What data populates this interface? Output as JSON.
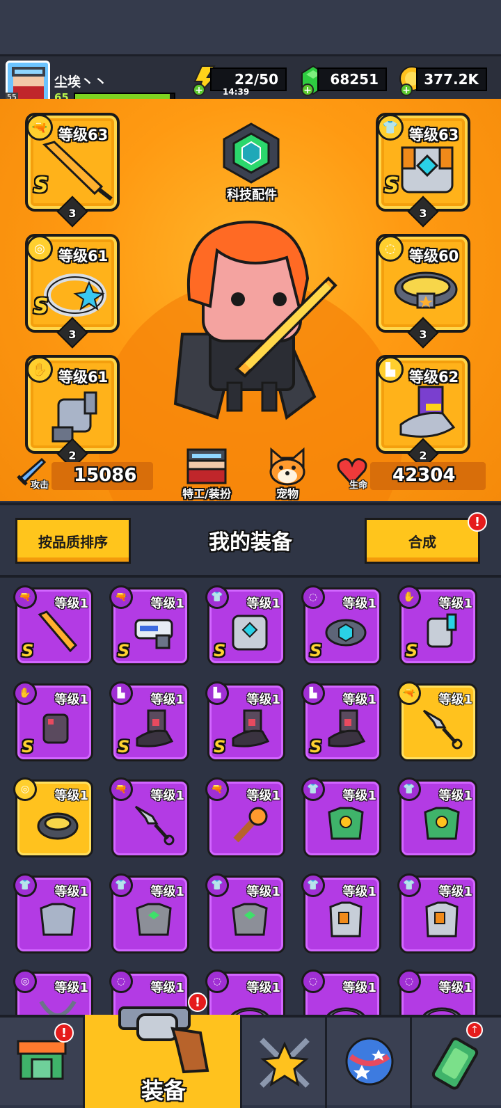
{
  "player": {
    "name": "尘埃丶丶",
    "level": "65",
    "avatar_badge": "55"
  },
  "resources": {
    "energy": "22/50",
    "energy_timer": "14:39",
    "gems": "68251",
    "coins": "377.2K"
  },
  "hero": {
    "tech_parts_label": "科技配件",
    "left_slots": [
      {
        "level": "等级63",
        "grade": "S",
        "stars": "3",
        "type": "weapon"
      },
      {
        "level": "等级61",
        "grade": "S",
        "stars": "3",
        "type": "ring"
      },
      {
        "level": "等级61",
        "grade": "",
        "stars": "2",
        "type": "glove"
      }
    ],
    "right_slots": [
      {
        "level": "等级63",
        "grade": "S",
        "stars": "3",
        "type": "armor"
      },
      {
        "level": "等级60",
        "grade": "",
        "stars": "3",
        "type": "belt"
      },
      {
        "level": "等级62",
        "grade": "",
        "stars": "2",
        "type": "boots"
      }
    ],
    "attack_label": "攻击",
    "attack_value": "15086",
    "agent_label": "特工/装扮",
    "pet_label": "宠物",
    "hp_label": "生命",
    "hp_value": "42304"
  },
  "section": {
    "sort_label": "按品质排序",
    "title": "我的装备",
    "merge_label": "合成"
  },
  "items": [
    {
      "level": "等级1",
      "grade": "S",
      "rarity": "purple",
      "icon": "sword"
    },
    {
      "level": "等级1",
      "grade": "S",
      "rarity": "purple",
      "icon": "blaster"
    },
    {
      "level": "等级1",
      "grade": "S",
      "rarity": "purple",
      "icon": "mech-armor"
    },
    {
      "level": "等级1",
      "grade": "S",
      "rarity": "purple",
      "icon": "tech-belt"
    },
    {
      "level": "等级1",
      "grade": "S",
      "rarity": "purple",
      "icon": "mech-glove"
    },
    {
      "level": "等级1",
      "grade": "S",
      "rarity": "purple",
      "icon": "dark-glove"
    },
    {
      "level": "等级1",
      "grade": "S",
      "rarity": "purple",
      "icon": "dark-boots"
    },
    {
      "level": "等级1",
      "grade": "S",
      "rarity": "purple",
      "icon": "dark-boots"
    },
    {
      "level": "等级1",
      "grade": "S",
      "rarity": "purple",
      "icon": "dark-boots"
    },
    {
      "level": "等级1",
      "grade": "",
      "rarity": "gold",
      "icon": "kunai"
    },
    {
      "level": "等级1",
      "grade": "",
      "rarity": "gold",
      "icon": "spike-collar"
    },
    {
      "level": "等级1",
      "grade": "",
      "rarity": "purple",
      "icon": "kunai"
    },
    {
      "level": "等级1",
      "grade": "",
      "rarity": "purple",
      "icon": "torch"
    },
    {
      "level": "等级1",
      "grade": "",
      "rarity": "purple",
      "icon": "green-armor"
    },
    {
      "level": "等级1",
      "grade": "",
      "rarity": "purple",
      "icon": "green-armor"
    },
    {
      "level": "等级1",
      "grade": "",
      "rarity": "purple",
      "icon": "steel-armor"
    },
    {
      "level": "等级1",
      "grade": "",
      "rarity": "purple",
      "icon": "gem-armor"
    },
    {
      "level": "等级1",
      "grade": "",
      "rarity": "purple",
      "icon": "gem-armor"
    },
    {
      "level": "等级1",
      "grade": "",
      "rarity": "purple",
      "icon": "vest"
    },
    {
      "level": "等级1",
      "grade": "",
      "rarity": "purple",
      "icon": "vest"
    },
    {
      "level": "等级1",
      "grade": "",
      "rarity": "purple",
      "icon": "necklace"
    },
    {
      "level": "等级1",
      "grade": "",
      "rarity": "purple",
      "icon": "belt"
    },
    {
      "level": "等级1",
      "grade": "",
      "rarity": "purple",
      "icon": "belt"
    },
    {
      "level": "等级1",
      "grade": "",
      "rarity": "purple",
      "icon": "belt"
    },
    {
      "level": "等级1",
      "grade": "",
      "rarity": "purple",
      "icon": "belt"
    }
  ],
  "nav": {
    "equip_label": "装备",
    "tabs": [
      "shop-icon",
      "equipment-icon",
      "talent-star-icon",
      "skill-orb-icon",
      "gene-icon"
    ]
  },
  "colors": {
    "orange": "#ff9a12",
    "gold": "#ffc51c",
    "purple": "#b33be4",
    "dark": "#2e3547",
    "red": "#e51c1c"
  }
}
